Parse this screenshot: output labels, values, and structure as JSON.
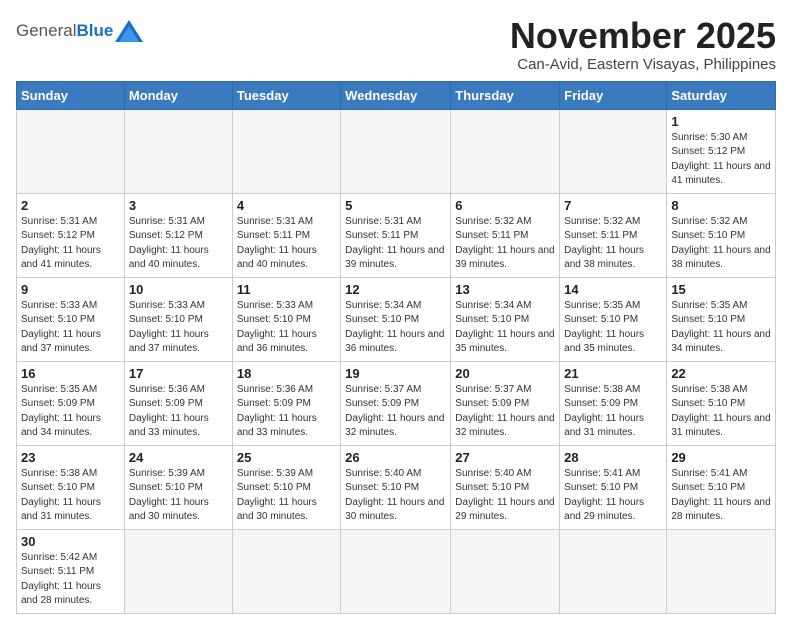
{
  "header": {
    "logo_general": "General",
    "logo_blue": "Blue",
    "month_title": "November 2025",
    "location": "Can-Avid, Eastern Visayas, Philippines"
  },
  "weekdays": [
    "Sunday",
    "Monday",
    "Tuesday",
    "Wednesday",
    "Thursday",
    "Friday",
    "Saturday"
  ],
  "days": [
    {
      "date": "",
      "sunrise": "",
      "sunset": "",
      "daylight": ""
    },
    {
      "date": "",
      "sunrise": "",
      "sunset": "",
      "daylight": ""
    },
    {
      "date": "",
      "sunrise": "",
      "sunset": "",
      "daylight": ""
    },
    {
      "date": "",
      "sunrise": "",
      "sunset": "",
      "daylight": ""
    },
    {
      "date": "",
      "sunrise": "",
      "sunset": "",
      "daylight": ""
    },
    {
      "date": "",
      "sunrise": "",
      "sunset": "",
      "daylight": ""
    },
    {
      "date": "1",
      "sunrise": "Sunrise: 5:30 AM",
      "sunset": "Sunset: 5:12 PM",
      "daylight": "Daylight: 11 hours and 41 minutes."
    },
    {
      "date": "2",
      "sunrise": "Sunrise: 5:31 AM",
      "sunset": "Sunset: 5:12 PM",
      "daylight": "Daylight: 11 hours and 41 minutes."
    },
    {
      "date": "3",
      "sunrise": "Sunrise: 5:31 AM",
      "sunset": "Sunset: 5:12 PM",
      "daylight": "Daylight: 11 hours and 40 minutes."
    },
    {
      "date": "4",
      "sunrise": "Sunrise: 5:31 AM",
      "sunset": "Sunset: 5:11 PM",
      "daylight": "Daylight: 11 hours and 40 minutes."
    },
    {
      "date": "5",
      "sunrise": "Sunrise: 5:31 AM",
      "sunset": "Sunset: 5:11 PM",
      "daylight": "Daylight: 11 hours and 39 minutes."
    },
    {
      "date": "6",
      "sunrise": "Sunrise: 5:32 AM",
      "sunset": "Sunset: 5:11 PM",
      "daylight": "Daylight: 11 hours and 39 minutes."
    },
    {
      "date": "7",
      "sunrise": "Sunrise: 5:32 AM",
      "sunset": "Sunset: 5:11 PM",
      "daylight": "Daylight: 11 hours and 38 minutes."
    },
    {
      "date": "8",
      "sunrise": "Sunrise: 5:32 AM",
      "sunset": "Sunset: 5:10 PM",
      "daylight": "Daylight: 11 hours and 38 minutes."
    },
    {
      "date": "9",
      "sunrise": "Sunrise: 5:33 AM",
      "sunset": "Sunset: 5:10 PM",
      "daylight": "Daylight: 11 hours and 37 minutes."
    },
    {
      "date": "10",
      "sunrise": "Sunrise: 5:33 AM",
      "sunset": "Sunset: 5:10 PM",
      "daylight": "Daylight: 11 hours and 37 minutes."
    },
    {
      "date": "11",
      "sunrise": "Sunrise: 5:33 AM",
      "sunset": "Sunset: 5:10 PM",
      "daylight": "Daylight: 11 hours and 36 minutes."
    },
    {
      "date": "12",
      "sunrise": "Sunrise: 5:34 AM",
      "sunset": "Sunset: 5:10 PM",
      "daylight": "Daylight: 11 hours and 36 minutes."
    },
    {
      "date": "13",
      "sunrise": "Sunrise: 5:34 AM",
      "sunset": "Sunset: 5:10 PM",
      "daylight": "Daylight: 11 hours and 35 minutes."
    },
    {
      "date": "14",
      "sunrise": "Sunrise: 5:35 AM",
      "sunset": "Sunset: 5:10 PM",
      "daylight": "Daylight: 11 hours and 35 minutes."
    },
    {
      "date": "15",
      "sunrise": "Sunrise: 5:35 AM",
      "sunset": "Sunset: 5:10 PM",
      "daylight": "Daylight: 11 hours and 34 minutes."
    },
    {
      "date": "16",
      "sunrise": "Sunrise: 5:35 AM",
      "sunset": "Sunset: 5:09 PM",
      "daylight": "Daylight: 11 hours and 34 minutes."
    },
    {
      "date": "17",
      "sunrise": "Sunrise: 5:36 AM",
      "sunset": "Sunset: 5:09 PM",
      "daylight": "Daylight: 11 hours and 33 minutes."
    },
    {
      "date": "18",
      "sunrise": "Sunrise: 5:36 AM",
      "sunset": "Sunset: 5:09 PM",
      "daylight": "Daylight: 11 hours and 33 minutes."
    },
    {
      "date": "19",
      "sunrise": "Sunrise: 5:37 AM",
      "sunset": "Sunset: 5:09 PM",
      "daylight": "Daylight: 11 hours and 32 minutes."
    },
    {
      "date": "20",
      "sunrise": "Sunrise: 5:37 AM",
      "sunset": "Sunset: 5:09 PM",
      "daylight": "Daylight: 11 hours and 32 minutes."
    },
    {
      "date": "21",
      "sunrise": "Sunrise: 5:38 AM",
      "sunset": "Sunset: 5:09 PM",
      "daylight": "Daylight: 11 hours and 31 minutes."
    },
    {
      "date": "22",
      "sunrise": "Sunrise: 5:38 AM",
      "sunset": "Sunset: 5:10 PM",
      "daylight": "Daylight: 11 hours and 31 minutes."
    },
    {
      "date": "23",
      "sunrise": "Sunrise: 5:38 AM",
      "sunset": "Sunset: 5:10 PM",
      "daylight": "Daylight: 11 hours and 31 minutes."
    },
    {
      "date": "24",
      "sunrise": "Sunrise: 5:39 AM",
      "sunset": "Sunset: 5:10 PM",
      "daylight": "Daylight: 11 hours and 30 minutes."
    },
    {
      "date": "25",
      "sunrise": "Sunrise: 5:39 AM",
      "sunset": "Sunset: 5:10 PM",
      "daylight": "Daylight: 11 hours and 30 minutes."
    },
    {
      "date": "26",
      "sunrise": "Sunrise: 5:40 AM",
      "sunset": "Sunset: 5:10 PM",
      "daylight": "Daylight: 11 hours and 30 minutes."
    },
    {
      "date": "27",
      "sunrise": "Sunrise: 5:40 AM",
      "sunset": "Sunset: 5:10 PM",
      "daylight": "Daylight: 11 hours and 29 minutes."
    },
    {
      "date": "28",
      "sunrise": "Sunrise: 5:41 AM",
      "sunset": "Sunset: 5:10 PM",
      "daylight": "Daylight: 11 hours and 29 minutes."
    },
    {
      "date": "29",
      "sunrise": "Sunrise: 5:41 AM",
      "sunset": "Sunset: 5:10 PM",
      "daylight": "Daylight: 11 hours and 28 minutes."
    },
    {
      "date": "30",
      "sunrise": "Sunrise: 5:42 AM",
      "sunset": "Sunset: 5:11 PM",
      "daylight": "Daylight: 11 hours and 28 minutes."
    }
  ]
}
